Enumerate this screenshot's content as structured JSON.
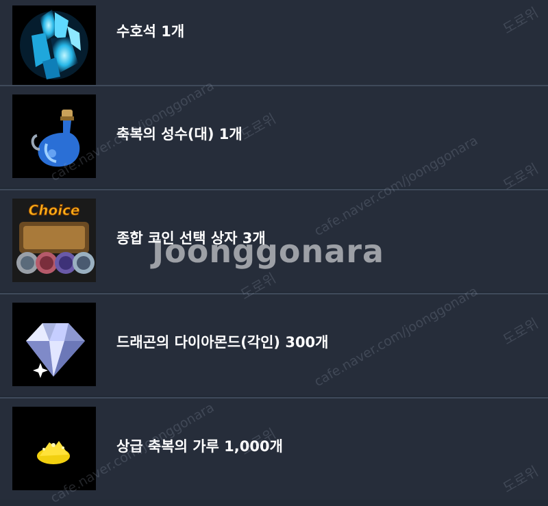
{
  "items": [
    {
      "label": "수호석 1개",
      "icon": "blue-crystal-icon"
    },
    {
      "label": "축복의 성수(대) 1개",
      "icon": "blue-potion-flask-icon"
    },
    {
      "label": "종합 코인 선택 상자 3개",
      "icon": "choice-coin-chest-icon",
      "icon_text": "Choice"
    },
    {
      "label": "드래곤의 다이아몬드(각인) 300개",
      "icon": "diamond-icon"
    },
    {
      "label": "상급 축복의 가루 1,000개",
      "icon": "golden-powder-icon"
    }
  ],
  "watermark": {
    "brand": "Joonggonara",
    "url": "cafe.naver.com/joonggonara",
    "korean": "도로위"
  },
  "colors": {
    "background": "#262d3a",
    "divider": "#3f4a5a",
    "text": "#ffffff"
  }
}
